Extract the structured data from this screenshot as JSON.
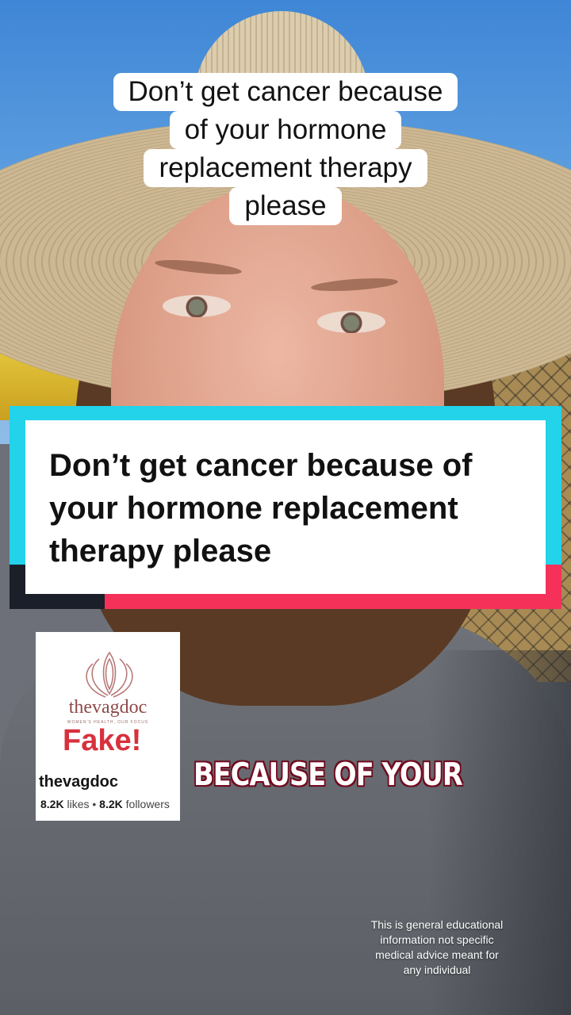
{
  "top_caption": {
    "lines": [
      "Don’t get cancer because",
      "of your hormone",
      "replacement therapy",
      "please"
    ]
  },
  "title_card": {
    "lines": [
      "Don’t get cancer because of",
      "your hormone replacement",
      "therapy please"
    ],
    "colors": {
      "cyan": "#22d3ea",
      "pink": "#f5315a",
      "dark": "#1b1f2a",
      "card": "#ffffff"
    }
  },
  "sticker": {
    "brand": "thevagdoc",
    "tagline": "WOMEN'S HEALTH, OUR FOCUS",
    "stamp": "Fake!",
    "handle": "thevagdoc",
    "likes_value": "8.2K",
    "likes_label": "likes",
    "separator": "•",
    "followers_value": "8.2K",
    "followers_label": "followers",
    "stamp_color": "#d8303d",
    "logo_icon": "lotus-logo-icon"
  },
  "live_subtitle": "BECAUSE OF YOUR",
  "disclaimer": {
    "lines": [
      "This is general educational",
      "information not specific",
      "medical advice meant for",
      "any individual"
    ]
  }
}
